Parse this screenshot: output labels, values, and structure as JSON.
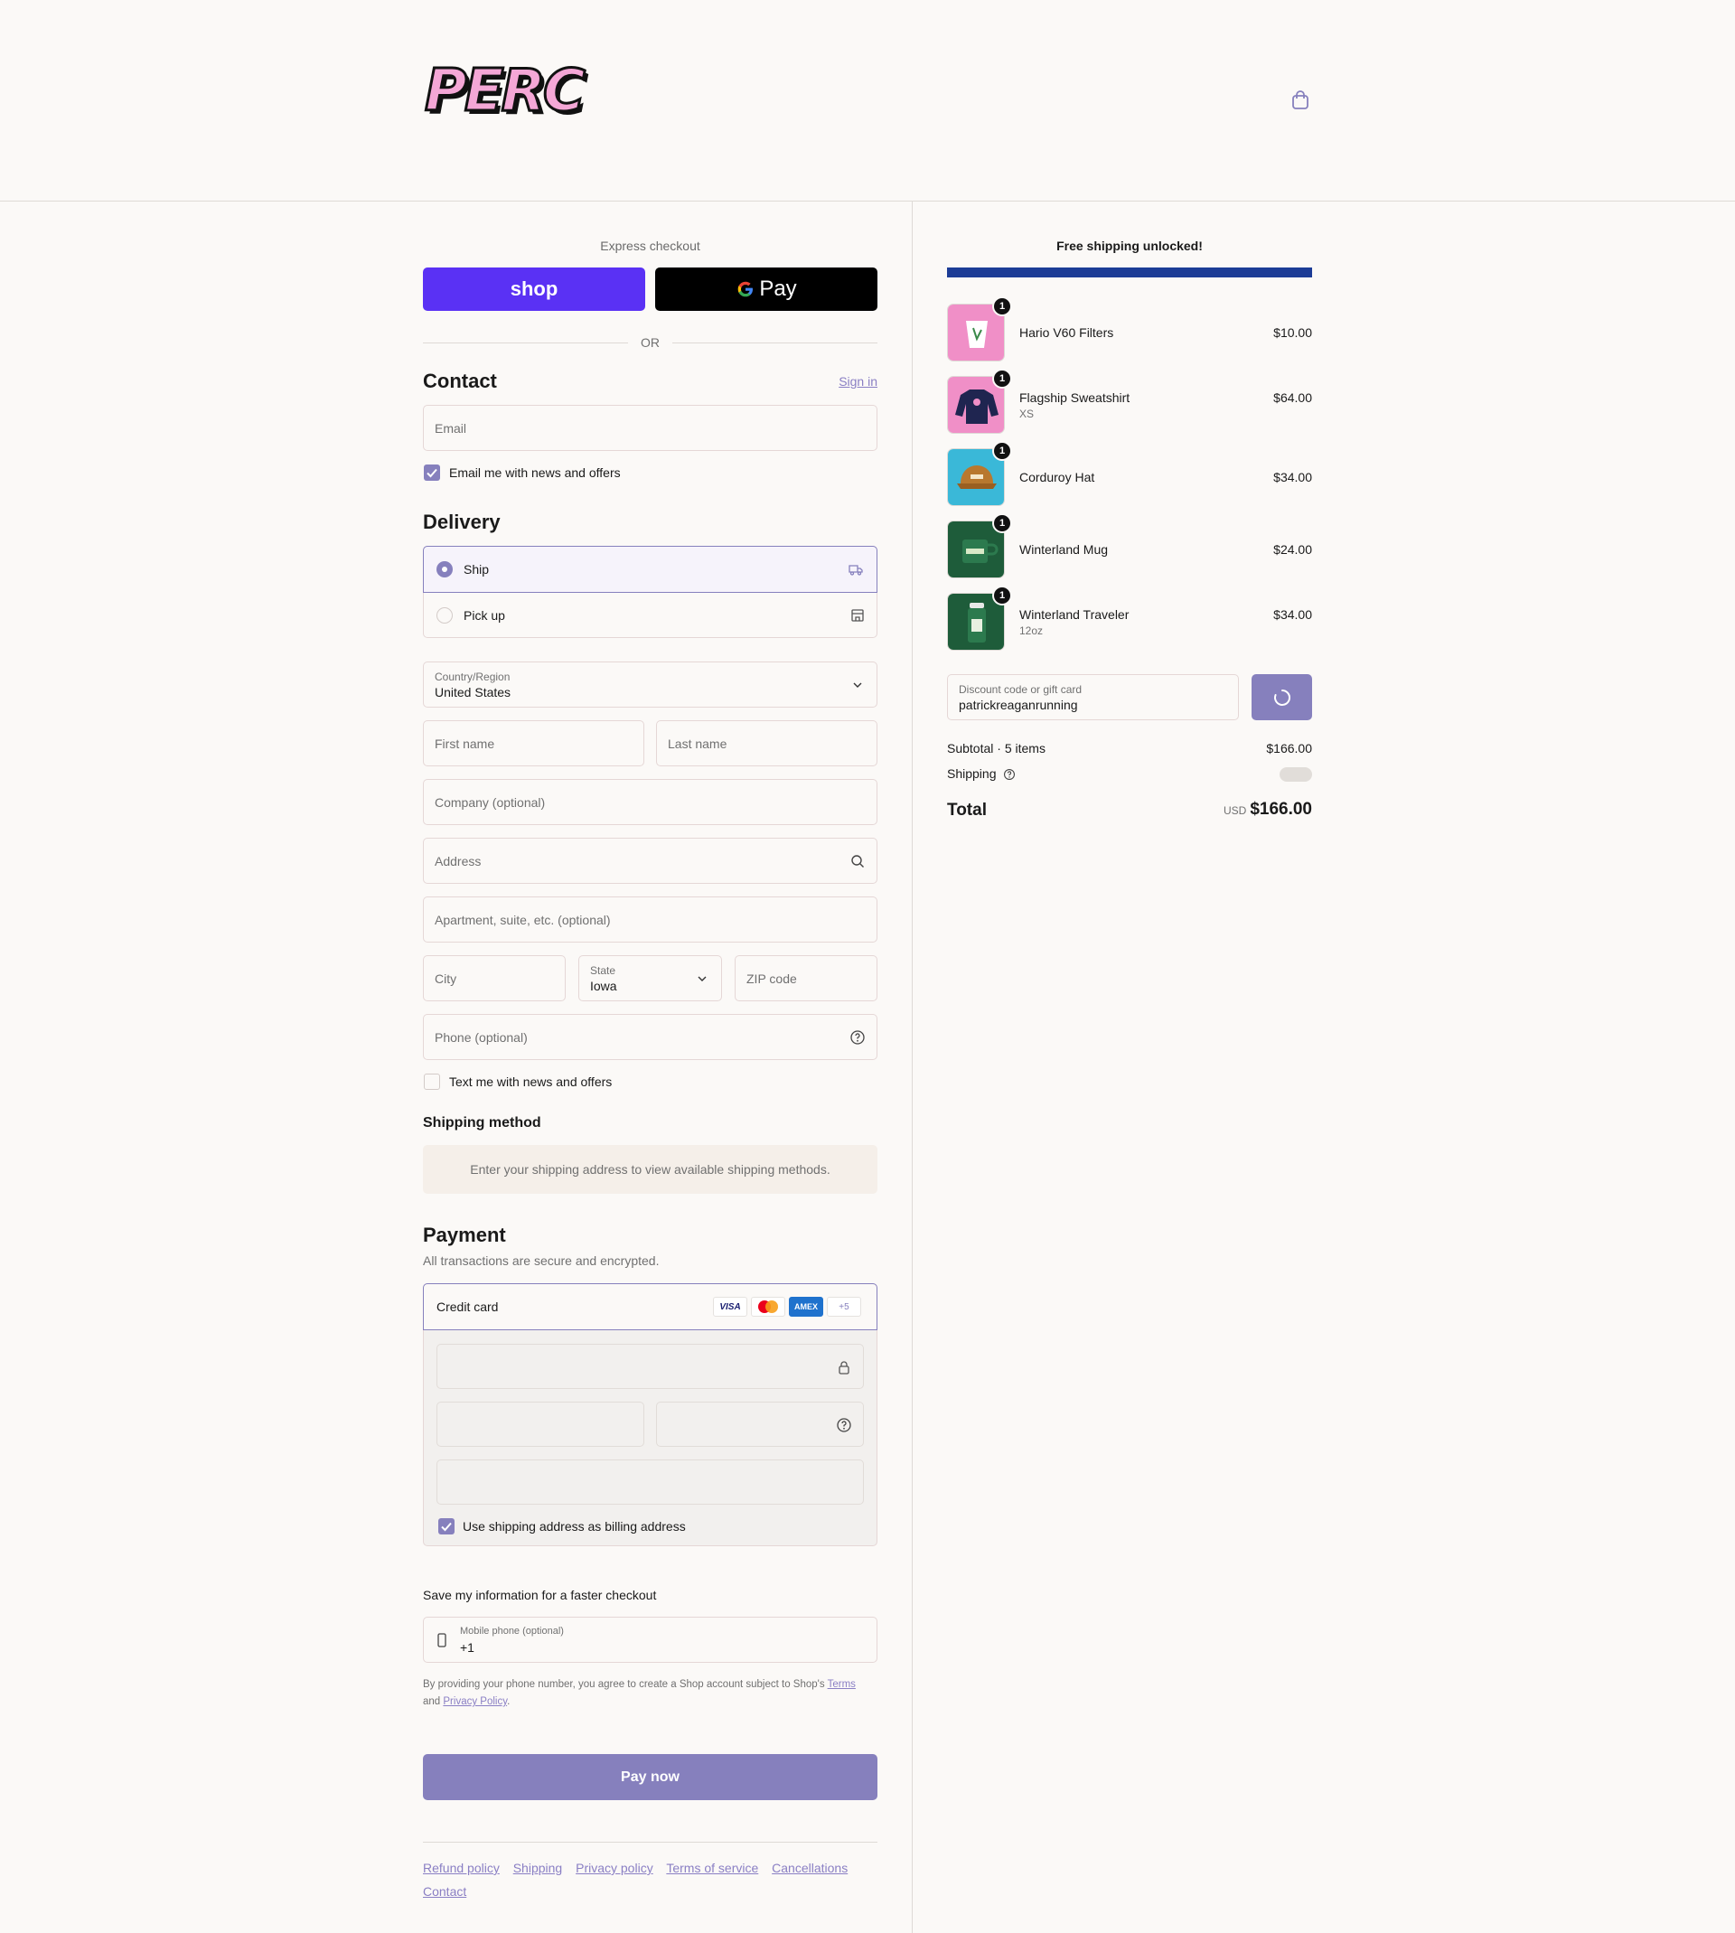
{
  "brand": {
    "logo_text": "PERC"
  },
  "header": {
    "cart_icon": "shopping-bag-icon"
  },
  "express": {
    "title": "Express checkout",
    "shop_pay_label": "shop",
    "gpay_label": "Pay",
    "or_label": "OR"
  },
  "contact": {
    "title": "Contact",
    "sign_in": "Sign in",
    "email_placeholder": "Email",
    "news_label": "Email me with news and offers",
    "news_checked": true
  },
  "delivery": {
    "title": "Delivery",
    "options": [
      {
        "label": "Ship",
        "selected": true,
        "icon": "truck-icon"
      },
      {
        "label": "Pick up",
        "selected": false,
        "icon": "store-icon"
      }
    ],
    "country_label": "Country/Region",
    "country_value": "United States",
    "first_name": "First name",
    "last_name": "Last name",
    "company": "Company (optional)",
    "address": "Address",
    "apartment": "Apartment, suite, etc. (optional)",
    "city": "City",
    "state_label": "State",
    "state_value": "Iowa",
    "zip": "ZIP code",
    "phone": "Phone (optional)",
    "text_label": "Text me with news and offers",
    "text_checked": false
  },
  "shipping_method": {
    "title": "Shipping method",
    "message": "Enter your shipping address to view available shipping methods."
  },
  "payment": {
    "title": "Payment",
    "subtitle": "All transactions are secure and encrypted.",
    "method": "Credit card",
    "badges": [
      "VISA",
      "",
      "AMEX",
      "+5"
    ],
    "billing_label": "Use shipping address as billing address",
    "billing_checked": true
  },
  "save_info": {
    "title": "Save my information for a faster checkout",
    "mobile_label": "Mobile phone (optional)",
    "mobile_value": "+1",
    "disclaimer_a": "By providing your phone number, you agree to create a Shop account subject to Shop's",
    "terms": "Terms",
    "and": "and",
    "privacy": "Privacy Policy",
    "period": "."
  },
  "pay_now": "Pay now",
  "footer_links": [
    "Refund policy",
    "Shipping",
    "Privacy policy",
    "Terms of service",
    "Cancellations",
    "Contact"
  ],
  "summary": {
    "free_shipping": "Free shipping unlocked!",
    "progress": 1.0,
    "items": [
      {
        "name": "Hario V60 Filters",
        "variant": "",
        "price": "$10.00",
        "qty": "1",
        "color": "#f08fc7"
      },
      {
        "name": "Flagship Sweatshirt",
        "variant": "XS",
        "price": "$64.00",
        "qty": "1",
        "color": "#f08fc7"
      },
      {
        "name": "Corduroy Hat",
        "variant": "",
        "price": "$34.00",
        "qty": "1",
        "color": "#3ab8d8"
      },
      {
        "name": "Winterland Mug",
        "variant": "",
        "price": "$24.00",
        "qty": "1",
        "color": "#1e5c3a"
      },
      {
        "name": "Winterland Traveler",
        "variant": "12oz",
        "price": "$34.00",
        "qty": "1",
        "color": "#1e5c3a"
      }
    ],
    "discount_label": "Discount code or gift card",
    "discount_value": "patrickreaganrunning",
    "subtotal_label": "Subtotal · 5 items",
    "subtotal_value": "$166.00",
    "shipping_label": "Shipping",
    "total_label": "Total",
    "currency": "USD",
    "total_value": "$166.00"
  },
  "colors": {
    "accent": "#8680bd",
    "shop": "#5a31f4",
    "progress": "#1c3c96"
  }
}
